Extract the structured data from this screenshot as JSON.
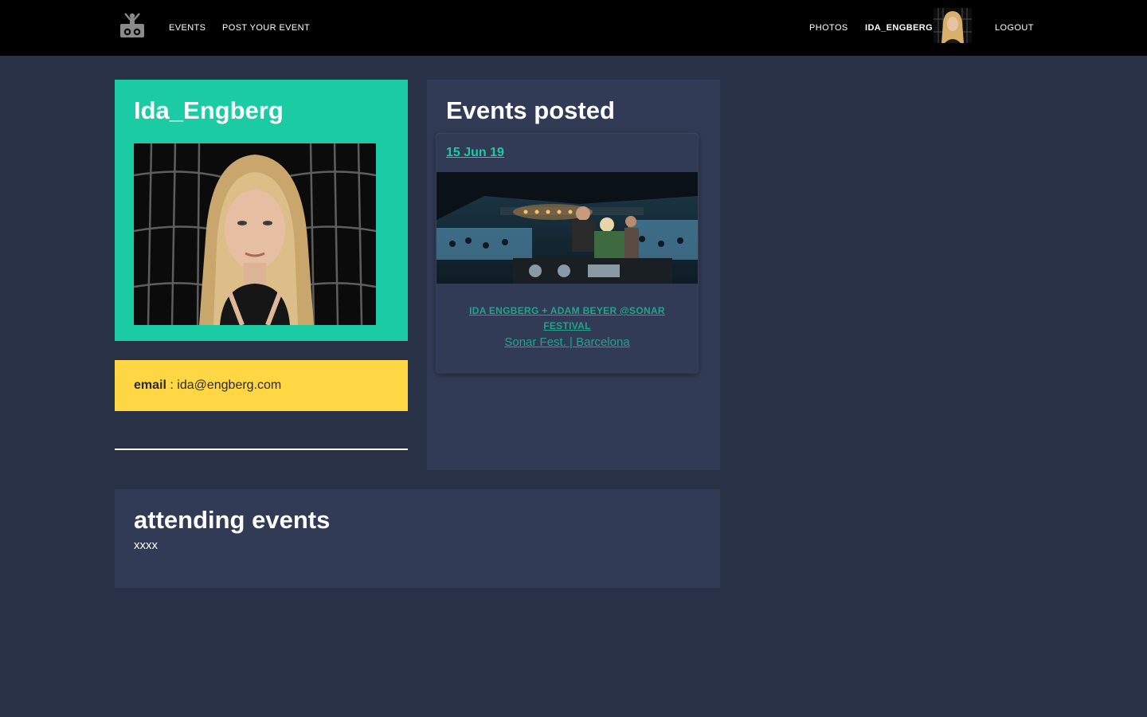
{
  "nav": {
    "logo_icon": "dj-robot-logo-icon",
    "left_links": [
      "EVENTS",
      "POST YOUR EVENT"
    ],
    "right_links": {
      "photos": "PHOTOS",
      "username": "IDA_ENGBERG",
      "logout": "LOGOUT"
    }
  },
  "profile": {
    "name": "Ida_Engberg",
    "email_label": "email",
    "email_sep": " : ",
    "email_value": "ida@engberg.com"
  },
  "events_posted": {
    "title": "Events posted",
    "events": [
      {
        "date": "15 Jun 19",
        "title": "IDA ENGBERG + ADAM BEYER @SONAR FESTIVAL",
        "venue": "Sonar Fest. | Barcelona"
      }
    ]
  },
  "attending": {
    "title": "attending events",
    "text": "xxxx"
  },
  "colors": {
    "background": "#283145",
    "panel": "#323b55",
    "accent_teal": "#1bcba3",
    "link_teal": "#1fa58c",
    "email_yellow": "#ffd644",
    "navbar": "#000000"
  }
}
